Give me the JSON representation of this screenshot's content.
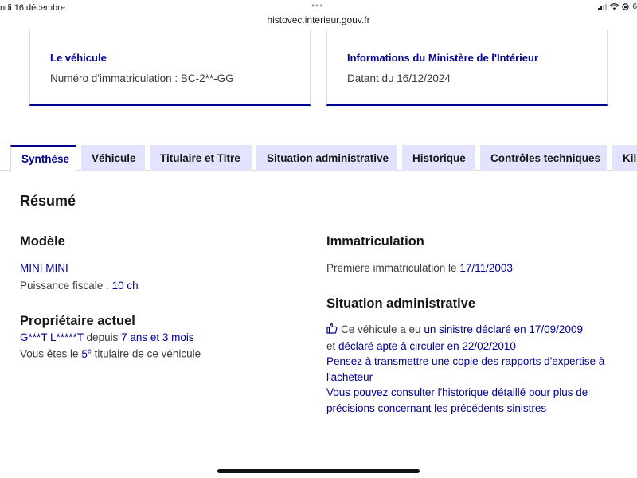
{
  "statusbar": {
    "date": "ndi 16 décembre",
    "url": "histovec.interieur.gouv.fr",
    "dots": "•••",
    "battery_text": "6"
  },
  "cards": {
    "vehicle": {
      "title": "Le véhicule",
      "text": "Numéro d'immatriculation : BC-2**-GG"
    },
    "ministry": {
      "title": "Informations du Ministère de l'Intérieur",
      "text": "Datant du 16/12/2024"
    }
  },
  "tabs": [
    {
      "label": "Synthèse",
      "active": true
    },
    {
      "label": "Véhicule"
    },
    {
      "label": "Titulaire et Titre"
    },
    {
      "label": "Situation administrative"
    },
    {
      "label": "Historique"
    },
    {
      "label": "Contrôles techniques"
    },
    {
      "label": "Kilo"
    }
  ],
  "summary": {
    "title": "Résumé",
    "model": {
      "heading": "Modèle",
      "name": "MINI MINI",
      "power_label": "Puissance fiscale : ",
      "power_value": "10 ch"
    },
    "owner": {
      "heading": "Propriétaire actuel",
      "name": "G***T L*****T",
      "since_label": " depuis ",
      "since_value": "7 ans et 3 mois",
      "rank_prefix": "Vous êtes le ",
      "rank_number": "5",
      "rank_suffix_sup": "e",
      "rank_suffix": " titulaire de ce véhicule"
    },
    "registration": {
      "heading": "Immatriculation",
      "label": "Première immatriculation le ",
      "date": "17/11/2003"
    },
    "admin": {
      "heading": "Situation administrative",
      "line1_text": "Ce véhicule a eu ",
      "line1_link": "un sinistre déclaré en 17/09/2009",
      "line2_text": "et ",
      "line2_link": "déclaré apte à circuler en 22/02/2010",
      "advice1_a": "Pensez à transmettre une copie des rapports d'expertise à",
      "advice1_b": "l'acheteur",
      "advice2_a": "Vous pouvez consulter l'historique détaillé pour plus de",
      "advice2_b": "précisions concernant les précédents sinistres",
      "icon": "thumbs-up-icon"
    }
  },
  "colors": {
    "accent": "#000091",
    "tab_bg": "#e3e3fd",
    "text": "#3a3a3a"
  }
}
